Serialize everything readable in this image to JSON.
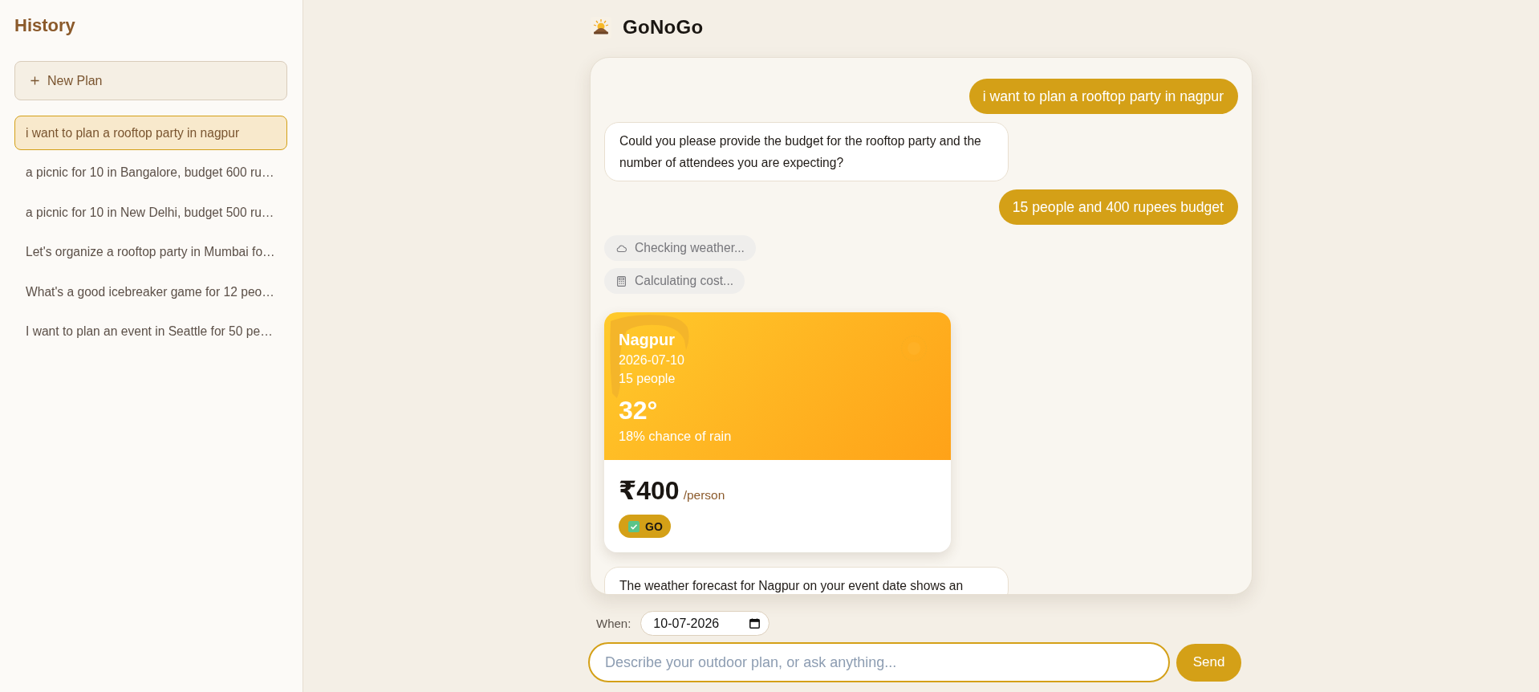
{
  "sidebar": {
    "title": "History",
    "new_plan_button": {
      "label": "New Plan"
    },
    "items": [
      {
        "label": "i want to plan a rooftop party in nagpur",
        "selected": true
      },
      {
        "label": "a picnic for 10 in Bangalore, budget 600 ru…",
        "selected": false
      },
      {
        "label": "a picnic for 10 in New Delhi, budget 500 ru…",
        "selected": false
      },
      {
        "label": "Let's organize a rooftop party in Mumbai fo…",
        "selected": false
      },
      {
        "label": "What's a good icebreaker game for 12 peo…",
        "selected": false
      },
      {
        "label": "I want to plan an event in Seattle for 50 pe…",
        "selected": false
      }
    ]
  },
  "header": {
    "title": "GoNoGo"
  },
  "chat": {
    "messages": [
      {
        "kind": "user",
        "text": "i want to plan a rooftop party in nagpur"
      },
      {
        "kind": "assistant",
        "text": "Could you please provide the budget for the rooftop party and the number of attendees you are expecting?"
      },
      {
        "kind": "user",
        "text": "15 people and 400 rupees budget"
      },
      {
        "kind": "weather",
        "text": "Checking weather..."
      },
      {
        "kind": "cost",
        "text": "Calculating cost..."
      },
      {
        "kind": "forecast",
        "city": "Nagpur",
        "date": "2026-07-10",
        "people": "15 people",
        "temperature": "32°",
        "rain": "18% chance of rain",
        "price": "₹400",
        "price_unit": "/person",
        "verdict": "GO"
      },
      {
        "kind": "assistant",
        "text": "The weather forecast for Nagpur on your event date shows an"
      }
    ]
  },
  "composer": {
    "date_label": "When:",
    "date_value": "10-07-2026",
    "message_input": {
      "placeholder": "Describe your outdoor plan, or ask anything..."
    },
    "send_button": {
      "label": "Send"
    }
  }
}
